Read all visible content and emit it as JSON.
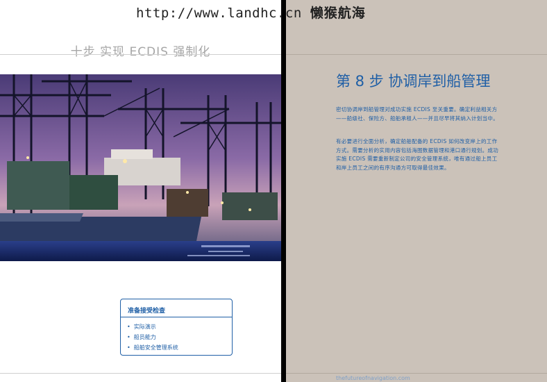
{
  "watermark": {
    "url": "http://www.landhc.cn",
    "brand": "懒猴航海"
  },
  "left_page": {
    "running_title": "十步 实现 ECDIS 强制化",
    "checklist": {
      "title": "准备接受检查",
      "items": [
        "实际演示",
        "船员能力",
        "船舶安全管理系统"
      ]
    }
  },
  "right_page": {
    "step_title": "第 8 步 协调岸到船管理",
    "paragraphs": [
      "密切协调岸到船管理对成功实施 ECDIS 至关重要。确定利益相关方——船级社、保险方、船舶承租人——并且尽早将其纳入计划当中。",
      "有必要进行全面分析，确定船舶配备的 ECDIS 如何改变岸上的工作方式。需要分析的实用内容包括海图数据管理和港口通行规划。成功实施 ECDIS 需要重新制定公司的安全管理系统，唯有通过船上员工和岸上员工之间的有序沟通方可取得最佳效果。"
    ],
    "footer_url": "thefutureofnavigation.com"
  },
  "icons": {
    "bullet": "•"
  },
  "colors": {
    "brand_blue": "#1f5fa6",
    "right_page_bg": "#cbc2b9",
    "running_title_grey": "#a6a6a6"
  }
}
